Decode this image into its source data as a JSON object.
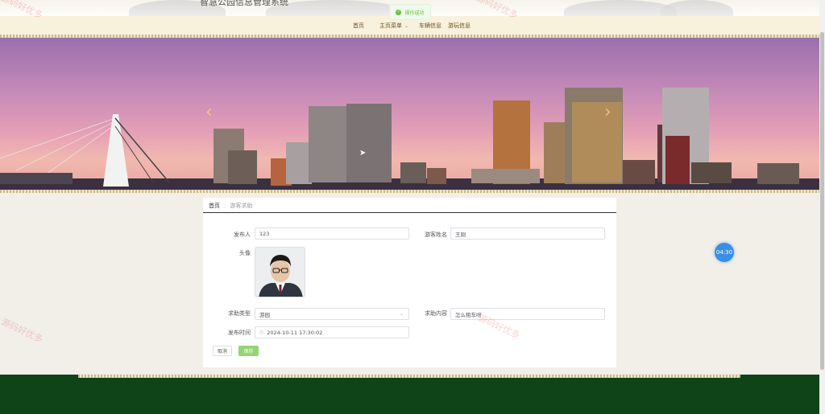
{
  "header": {
    "site_title": "智慧公园信息管理系统",
    "toast": "操作成功",
    "nav": [
      {
        "label": "首页"
      },
      {
        "label": "主页菜单"
      },
      {
        "label": "车辆信息"
      },
      {
        "label": "游玩信息"
      }
    ]
  },
  "banner": {
    "prev": "‹",
    "next": "›"
  },
  "breadcrumb": {
    "home": "首页",
    "current": "游客求助"
  },
  "form": {
    "publisher_label": "发布人",
    "publisher_value": "123",
    "visitor_name_label": "游客姓名",
    "visitor_name_value": "王刚",
    "avatar_label": "头像",
    "help_type_label": "求助类型",
    "help_type_value": "游园",
    "help_content_label": "求助内容",
    "help_content_value": "怎么租车呀",
    "publish_time_label": "发布时间",
    "publish_time_value": "2024-10-11 17:30:02",
    "cancel_label": "取消",
    "save_label": "保存"
  },
  "timer": "04:30",
  "watermark": "源码好优多",
  "colors": {
    "footer": "#0f4418",
    "save_button": "#95d475",
    "toast_text": "#67c23a",
    "timer": "#3a8ee6"
  }
}
